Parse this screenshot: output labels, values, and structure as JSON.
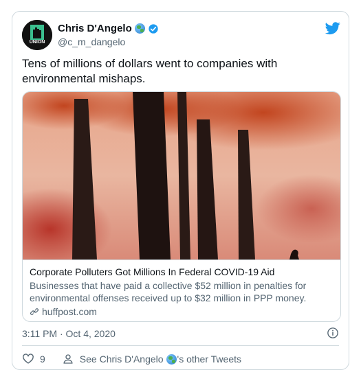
{
  "author": {
    "name": "Chris D'Angelo",
    "handle": "@c_m_dangelo",
    "avatar_text": "UNION"
  },
  "tweet": {
    "text": "Tens of millions of dollars went to companies with environmental mishaps."
  },
  "link_card": {
    "title": "Corporate Polluters Got Millions In Federal COVID-19 Aid",
    "description": "Businesses that have paid a collective $52 million in penalties for environmental offenses received up to $32 million in PPP money.",
    "domain": "huffpost.com"
  },
  "timestamp": "3:11 PM · Oct 4, 2020",
  "actions": {
    "like_count": "9",
    "profile_link_prefix": "See Chris D'Angelo",
    "profile_link_suffix": "'s other Tweets"
  },
  "colors": {
    "twitter_blue": "#1d9bf0",
    "text_secondary": "#536471",
    "border": "#cfd9de"
  },
  "icons": [
    "twitter-bird-icon",
    "verified-badge-icon",
    "globe-emoji-icon",
    "info-icon",
    "heart-icon",
    "person-icon",
    "link-icon"
  ]
}
